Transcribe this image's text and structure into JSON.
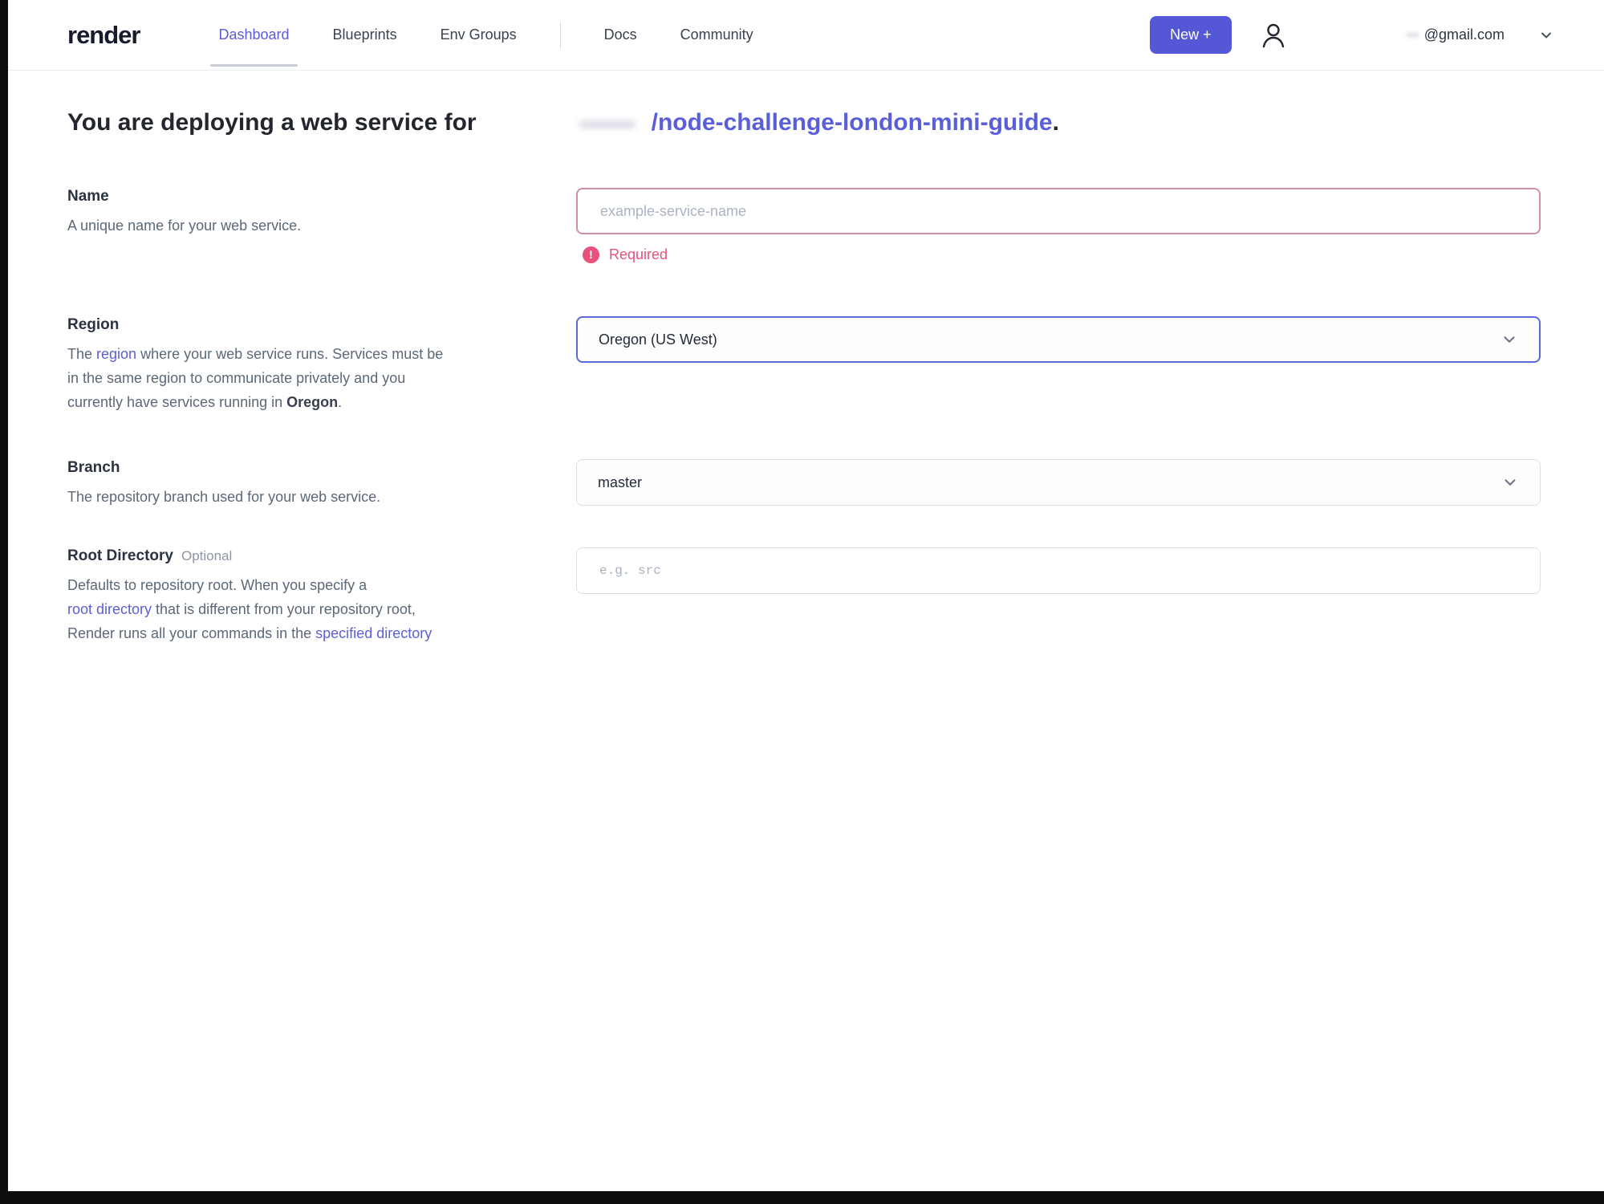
{
  "colors": {
    "accent": "#5a5cd6",
    "new_button_bg": "#5558d6",
    "error": "#e5537d",
    "error_border": "#cf8fa2",
    "focus_border": "#5c68d8"
  },
  "nav": {
    "logo": "render",
    "tabs": [
      {
        "label": "Dashboard"
      },
      {
        "label": "Blueprints"
      },
      {
        "label": "Env Groups"
      },
      {
        "label": "Docs"
      },
      {
        "label": "Community"
      }
    ],
    "new_button": "New +",
    "account_email": "@gmail.com"
  },
  "heading": {
    "pre": "You are deploying a web service for",
    "repo_link": "/node-challenge-london-mini-guide",
    "suffix": "."
  },
  "form": {
    "name": {
      "label": "Name",
      "desc": "A unique name for your web service.",
      "placeholder": "example-service-name",
      "error": "Required"
    },
    "region": {
      "label": "Region",
      "desc_l1_pre": "The ",
      "desc_l1_link": "region",
      "desc_l1_post": " where your web service runs. Services must be",
      "desc_l2": "in the same region to communicate privately and you",
      "desc_l3_pre": "currently have services running in ",
      "desc_l3_strong": "Oregon",
      "desc_l3_post": ".",
      "value": "Oregon (US West)"
    },
    "branch": {
      "label": "Branch",
      "desc": "The repository branch used for your web service.",
      "value": "master"
    },
    "root_directory": {
      "label": "Root Directory",
      "optional_tag": "Optional",
      "desc_l1": "Defaults to repository root. When you specify a",
      "desc_l2_link": "root directory",
      "desc_l2_post": " that is different from your repository root,",
      "desc_l3_pre": "Render runs all your commands in the ",
      "desc_l3_link": "specified directory",
      "placeholder": "e.g. src"
    }
  }
}
